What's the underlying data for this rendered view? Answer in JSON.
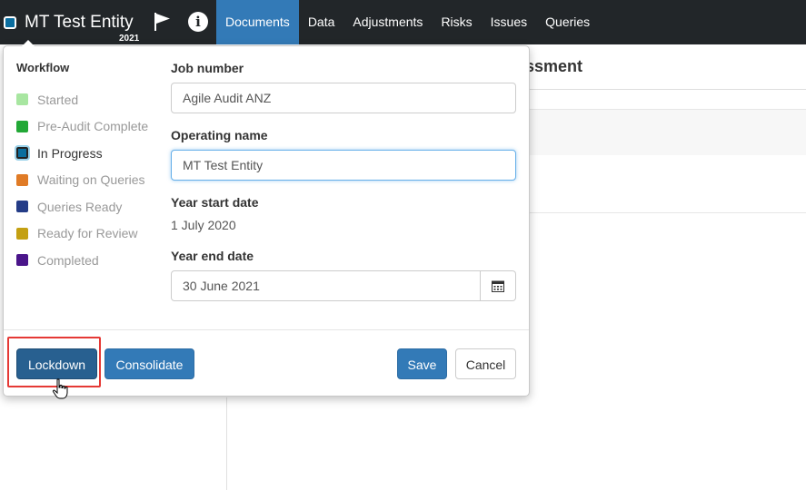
{
  "header": {
    "entity_name": "MT Test Entity",
    "entity_year": "2021",
    "nav": [
      "Documents",
      "Data",
      "Adjustments",
      "Risks",
      "Issues",
      "Queries"
    ],
    "active_nav": 0
  },
  "background": {
    "title_fragment": "ssment"
  },
  "workflow": {
    "heading": "Workflow",
    "items": [
      {
        "label": "Started",
        "color": "#a8e6a1"
      },
      {
        "label": "Pre-Audit Complete",
        "color": "#22a836"
      },
      {
        "label": "In Progress",
        "color": "#0a6e9e",
        "current": true
      },
      {
        "label": "Waiting on Queries",
        "color": "#e07b26"
      },
      {
        "label": "Queries Ready",
        "color": "#243c87"
      },
      {
        "label": "Ready for Review",
        "color": "#c4a012"
      },
      {
        "label": "Completed",
        "color": "#4a158a"
      }
    ]
  },
  "form": {
    "job_number_label": "Job number",
    "job_number_value": "Agile Audit ANZ",
    "operating_name_label": "Operating name",
    "operating_name_value": "MT Test Entity",
    "year_start_label": "Year start date",
    "year_start_value": "1 July 2020",
    "year_end_label": "Year end date",
    "year_end_value": "30 June 2021"
  },
  "buttons": {
    "lockdown": "Lockdown",
    "consolidate": "Consolidate",
    "save": "Save",
    "cancel": "Cancel"
  },
  "colors": {
    "topbar": "#222629",
    "accent": "#337ab7",
    "highlight": "#e53935"
  }
}
